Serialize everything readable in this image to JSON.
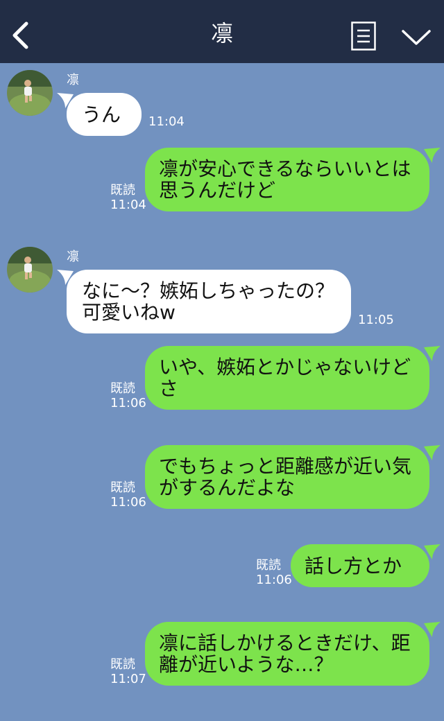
{
  "header": {
    "title": "凛",
    "icons": [
      "back-icon",
      "note-icon",
      "chevron-down-icon"
    ]
  },
  "colors": {
    "header_bg": "#222d45",
    "chat_bg": "#7292c0",
    "outgoing_bubble": "#7de34c",
    "incoming_bubble": "#ffffff"
  },
  "messages": [
    {
      "direction": "in",
      "sender": "凛",
      "text": "うん",
      "time": "11:04"
    },
    {
      "direction": "out",
      "text": "凛が安心できるならいいとは思うんだけど",
      "read": "既読",
      "time": "11:04"
    },
    {
      "direction": "in",
      "sender": "凛",
      "text": "なに〜？嫉妬しちゃったの？可愛いねw",
      "time": "11:05"
    },
    {
      "direction": "out",
      "text": "いや、嫉妬とかじゃないけどさ",
      "read": "既読",
      "time": "11:06"
    },
    {
      "direction": "out",
      "text": "でもちょっと距離感が近い気がするんだよな",
      "read": "既読",
      "time": "11:06"
    },
    {
      "direction": "out",
      "text": "話し方とか",
      "read": "既読",
      "time": "11:06"
    },
    {
      "direction": "out",
      "text": "凛に話しかけるときだけ、距離が近いような…？",
      "read": "既読",
      "time": "11:07"
    }
  ]
}
